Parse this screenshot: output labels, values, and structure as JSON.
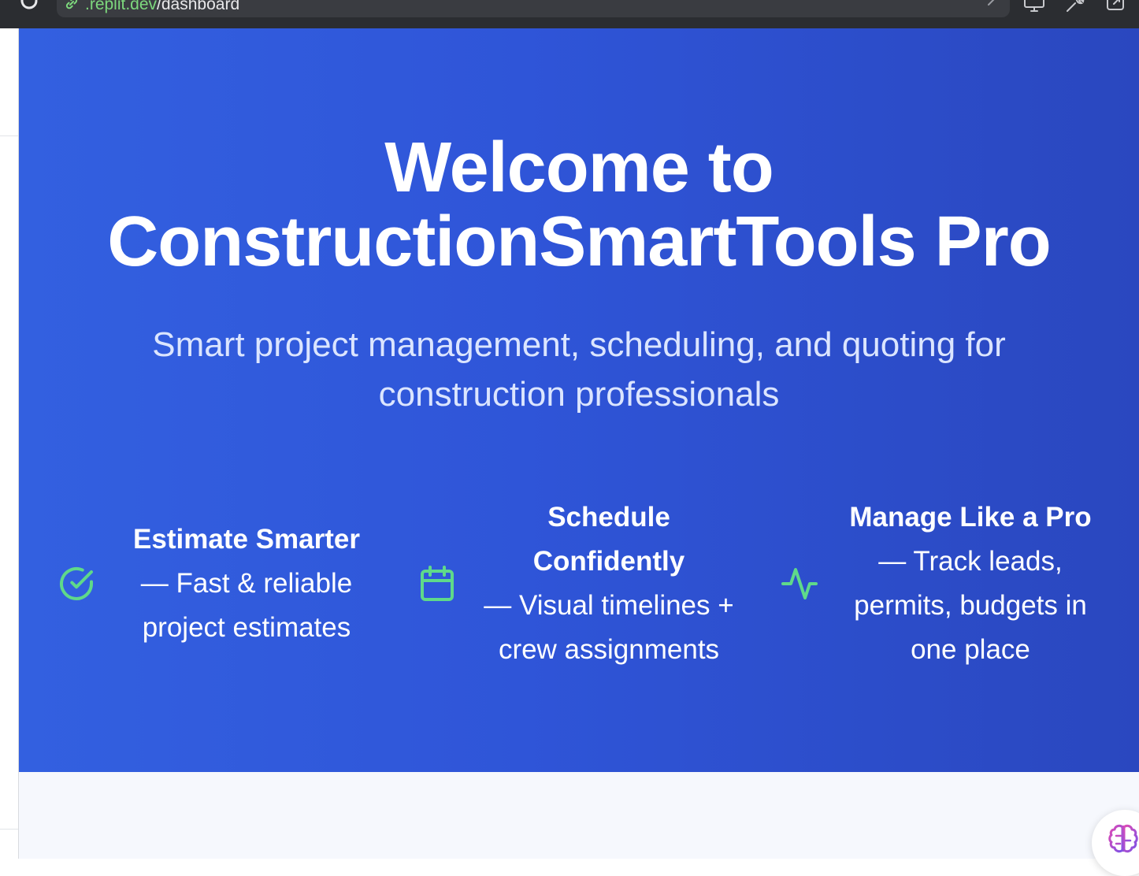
{
  "browser": {
    "url_domain": ".replit.dev",
    "url_path": "/dashboard",
    "icons": [
      "reload-icon",
      "link-icon",
      "chevron-icon",
      "monitor-icon",
      "wrench-icon",
      "open-external-icon"
    ]
  },
  "hero": {
    "title_line1": "Welcome to",
    "title_line2": "ConstructionSmartTools Pro",
    "subtitle": "Smart project management, scheduling, and quoting for construction professionals",
    "features": [
      {
        "icon": "check-circle-icon",
        "title": "Estimate Smarter",
        "description": "— Fast & reliable project estimates"
      },
      {
        "icon": "calendar-icon",
        "title": "Schedule Confidently",
        "description": "— Visual timelines + crew assignments"
      },
      {
        "icon": "activity-icon",
        "title": "Manage Like a Pro",
        "description": "— Track leads, permits, budgets in one place"
      }
    ]
  },
  "assistant": {
    "icon": "brain-icon"
  },
  "colors": {
    "hero_start": "#3360e0",
    "hero_end": "#2a47bf",
    "icon_green": "#5fd98a",
    "browser_bar": "#2b2d31",
    "url_green": "#7dd87d"
  }
}
